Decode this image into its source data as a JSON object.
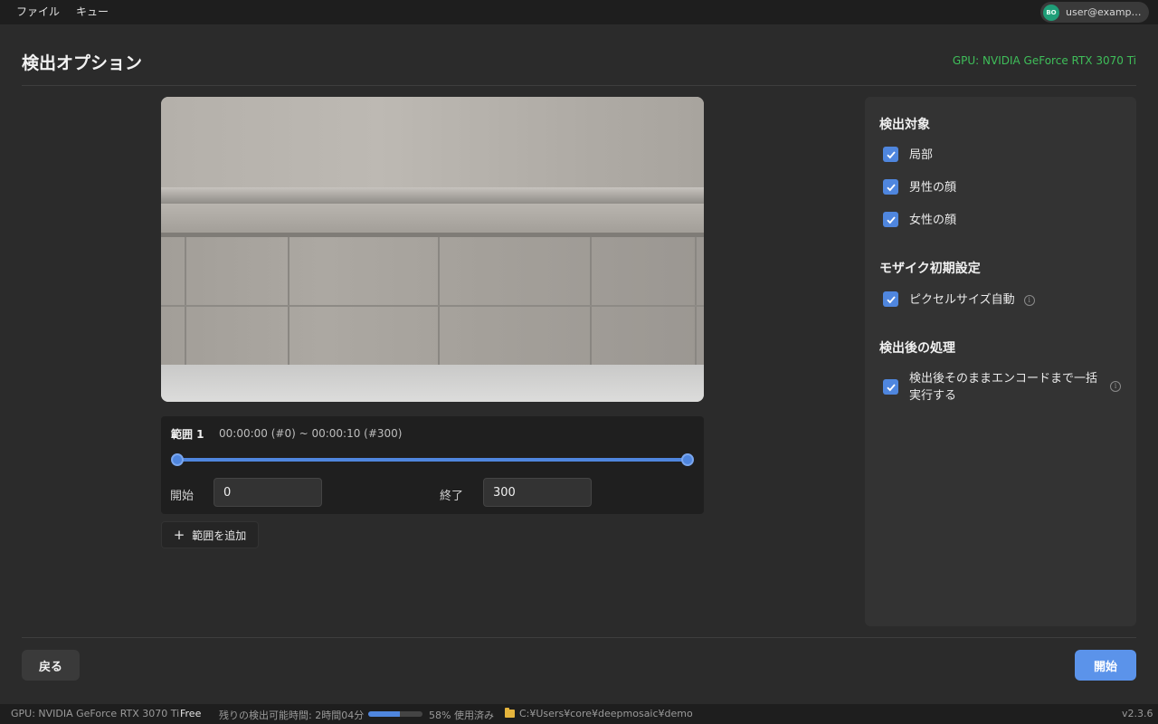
{
  "menubar": {
    "items": [
      "ファイル",
      "キュー"
    ],
    "account": {
      "initials": "BO",
      "email": "user@example.com"
    }
  },
  "header": {
    "title": "検出オプション",
    "gpu": "GPU: NVIDIA GeForce RTX 3070 Ti"
  },
  "range": {
    "title": "範囲 1",
    "time": "00:00:00 (#0) ~ 00:00:10 (#300)",
    "start_label": "開始",
    "start_value": "0",
    "end_label": "終了",
    "end_value": "300"
  },
  "add_range_label": "範囲を追加",
  "options": {
    "detect_targets": {
      "title": "検出対象",
      "items": [
        {
          "label": "局部",
          "checked": true
        },
        {
          "label": "男性の顔",
          "checked": true
        },
        {
          "label": "女性の顔",
          "checked": true
        }
      ]
    },
    "mosaic": {
      "title": "モザイク初期設定",
      "items": [
        {
          "label": "ピクセルサイズ自動",
          "checked": true
        }
      ]
    },
    "post": {
      "title": "検出後の処理",
      "items": [
        {
          "label": "検出後そのままエンコードまで一括実行する",
          "checked": true
        }
      ]
    }
  },
  "footer": {
    "back_label": "戻る",
    "start_label": "開始"
  },
  "statusbar": {
    "gpu": "GPU: NVIDIA GeForce RTX 3070 Ti",
    "plan": "Free",
    "remaining": "残りの検出可能時間: 2時間04分",
    "usage_percent": 58,
    "usage_text": "58% 使用済み",
    "path": "C:¥Users¥core¥deepmosaic¥demo",
    "version": "v2.3.6"
  },
  "colors": {
    "accent": "#4f86de",
    "gpu_text": "#3fbf5a"
  }
}
